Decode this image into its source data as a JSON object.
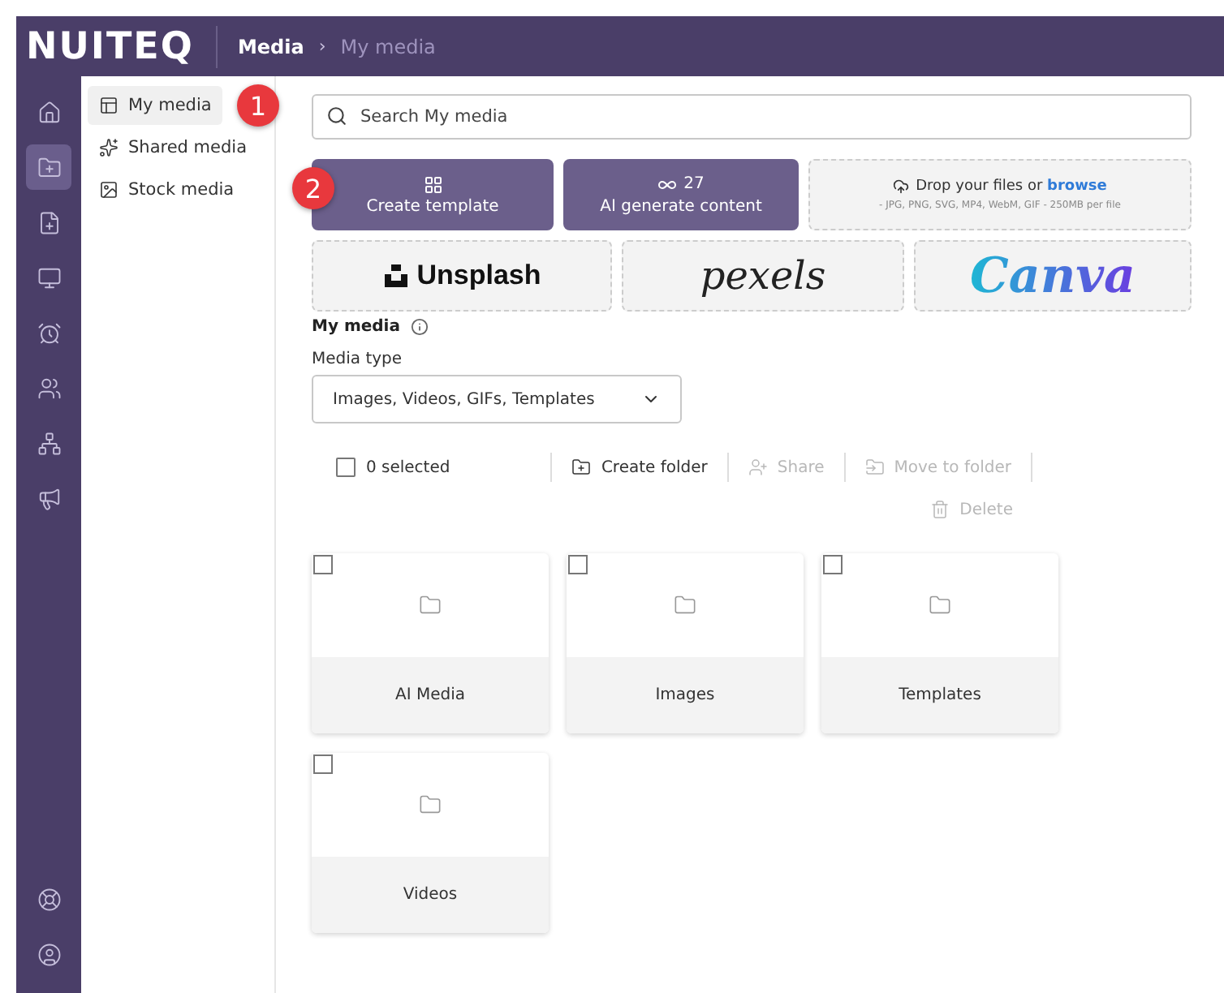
{
  "header": {
    "logo": "NUITEQ",
    "separator": "›",
    "breadcrumb": [
      {
        "label": "Media",
        "current": false
      },
      {
        "label": "My media",
        "current": true
      }
    ]
  },
  "rail": {
    "items": [
      {
        "kind": "home",
        "selected": false
      },
      {
        "kind": "media",
        "selected": true
      },
      {
        "kind": "lesson",
        "selected": false
      },
      {
        "kind": "screen",
        "selected": false
      },
      {
        "kind": "alarm",
        "selected": false
      },
      {
        "kind": "users",
        "selected": false
      },
      {
        "kind": "org",
        "selected": false
      },
      {
        "kind": "announce",
        "selected": false
      }
    ],
    "bottom": [
      {
        "kind": "help"
      },
      {
        "kind": "account"
      }
    ]
  },
  "submenu": [
    {
      "label": "My media",
      "kind": "layout",
      "selected": true,
      "callout": "1"
    },
    {
      "label": "Shared media",
      "kind": "sparkle",
      "selected": false
    },
    {
      "label": "Stock media",
      "kind": "image",
      "selected": false
    }
  ],
  "search": {
    "placeholder": "Search My media"
  },
  "actions": [
    {
      "kind": "template",
      "label": "Create template",
      "callout": "2"
    },
    {
      "kind": "ai",
      "label": "AI generate content",
      "count": "27"
    }
  ],
  "dropzone": {
    "text": "Drop your files or ",
    "link": "browse",
    "hint": "- JPG, PNG, SVG, MP4, WebM, GIF - 250MB per file"
  },
  "providers": [
    {
      "kind": "unsplash",
      "label": "Unsplash"
    },
    {
      "kind": "pexels",
      "label": "pexels"
    },
    {
      "kind": "canva",
      "label": "Canva"
    }
  ],
  "section_title": "My media",
  "filter": {
    "label": "Media type",
    "value": "Images, Videos, GIFs, Templates"
  },
  "toolbar": {
    "checked": false,
    "selected_text": "0 selected",
    "buttons": [
      {
        "kind": "folder",
        "label": "Create folder",
        "disabled": false
      },
      {
        "kind": "share",
        "label": "Share",
        "disabled": true
      },
      {
        "kind": "move",
        "label": "Move to folder",
        "disabled": true
      },
      {
        "kind": "delete",
        "label": "Delete",
        "disabled": true
      }
    ]
  },
  "folders": [
    {
      "name": "AI Media",
      "checked": false
    },
    {
      "name": "Images",
      "checked": false
    },
    {
      "name": "Templates",
      "checked": false
    },
    {
      "name": "Videos",
      "checked": false
    }
  ]
}
